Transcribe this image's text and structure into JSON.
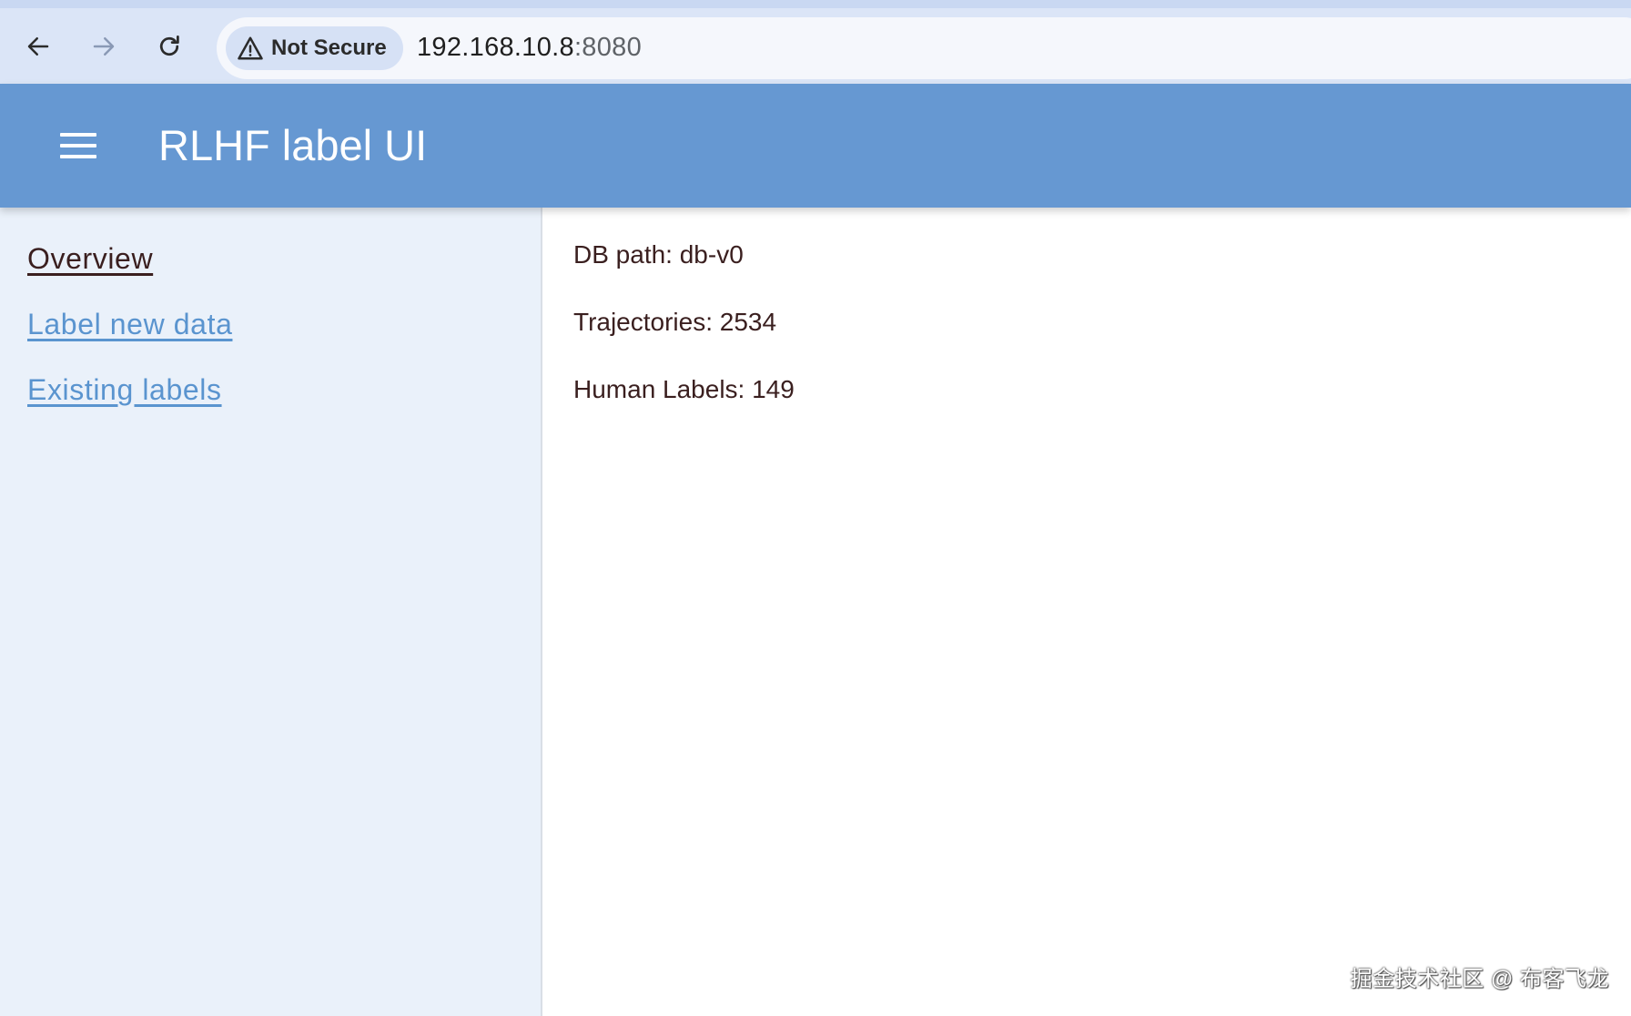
{
  "browser": {
    "back_icon": "arrow-left-icon",
    "forward_icon": "arrow-right-icon",
    "reload_icon": "reload-icon",
    "security_icon": "warning-triangle-icon",
    "security_label": "Not Secure",
    "url_host": "192.168.10.8",
    "url_port": ":8080"
  },
  "header": {
    "menu_icon": "hamburger-menu-icon",
    "title": "RLHF label UI",
    "color": "#6698d2"
  },
  "sidebar": {
    "items": [
      {
        "label": "Overview",
        "active": true
      },
      {
        "label": "Label new data",
        "active": false
      },
      {
        "label": "Existing labels",
        "active": false
      }
    ],
    "background": "#eaf1fa",
    "link_color": "#5a94cf"
  },
  "main": {
    "db_path": "DB path: db-v0",
    "trajectories": "Trajectories: 2534",
    "human_labels": "Human Labels: 149"
  },
  "watermark": "掘金技术社区 @ 布客飞龙"
}
